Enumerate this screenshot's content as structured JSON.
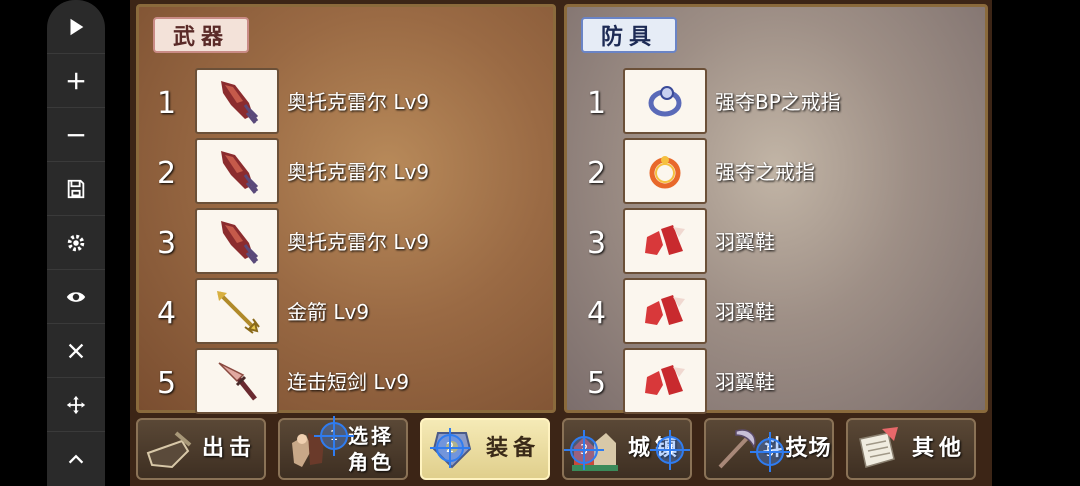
{
  "toolbar": {
    "buttons": [
      {
        "name": "play-icon"
      },
      {
        "name": "plus-icon"
      },
      {
        "name": "minus-icon"
      },
      {
        "name": "save-icon"
      },
      {
        "name": "gear-icon"
      },
      {
        "name": "eye-icon"
      },
      {
        "name": "close-icon"
      },
      {
        "name": "move-icon"
      },
      {
        "name": "chevron-up-icon"
      }
    ]
  },
  "weapons": {
    "title": "武器",
    "items": [
      {
        "num": "1",
        "name": "奥托克雷尔 Lv9",
        "icon": "claw-weapon-icon"
      },
      {
        "num": "2",
        "name": "奥托克雷尔 Lv9",
        "icon": "claw-weapon-icon"
      },
      {
        "num": "3",
        "name": "奥托克雷尔 Lv9",
        "icon": "claw-weapon-icon"
      },
      {
        "num": "4",
        "name": "金箭 Lv9",
        "icon": "golden-arrow-icon"
      },
      {
        "num": "5",
        "name": "连击短剑 Lv9",
        "icon": "dagger-icon"
      }
    ]
  },
  "armor": {
    "title": "防具",
    "items": [
      {
        "num": "1",
        "name": "强夺BP之戒指",
        "icon": "blue-ring-icon"
      },
      {
        "num": "2",
        "name": "强夺之戒指",
        "icon": "gold-ring-icon"
      },
      {
        "num": "3",
        "name": "羽翼鞋",
        "icon": "red-boots-icon"
      },
      {
        "num": "4",
        "name": "羽翼鞋",
        "icon": "red-boots-icon"
      },
      {
        "num": "5",
        "name": "羽翼鞋",
        "icon": "red-boots-icon"
      }
    ]
  },
  "nav": {
    "sortie": "出击",
    "select_line1": "选择",
    "select_line2": "角色",
    "equipment": "装备",
    "town": "城镇",
    "arena": "斗技场",
    "other": "其他",
    "markers": [
      "1",
      "2",
      "3",
      "4",
      "5"
    ]
  },
  "colors": {
    "weapon_panel": "#9a6a44",
    "armor_panel": "#9e8f86",
    "active_nav": "#f5eab6",
    "touch_marker": "#2f7cf0"
  }
}
